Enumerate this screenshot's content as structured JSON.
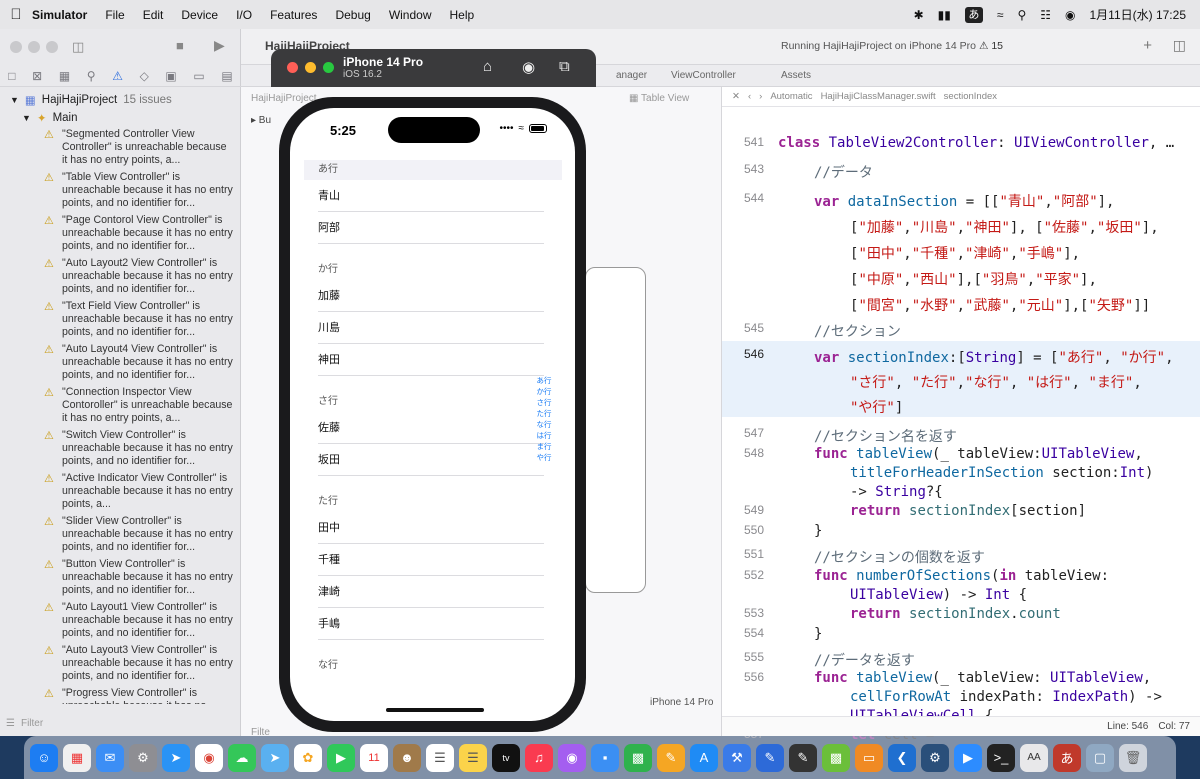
{
  "menubar": {
    "items": [
      "Simulator",
      "File",
      "Edit",
      "Device",
      "I/O",
      "Features",
      "Debug",
      "Window",
      "Help"
    ],
    "input_mode": "あ",
    "datetime": "1月11日(水) 17:25"
  },
  "xcode": {
    "project_title": "HajiHajiProject",
    "status": "Running HajiHajiProject on iPhone 14 Pro",
    "issue_count": "15",
    "tabs": [
      "anager",
      "ViewController",
      "Assets"
    ],
    "breadcrumb_left": "HajiHajiProject",
    "device_label": "iPhone 14 Pro",
    "filter_placeholder": "Filter"
  },
  "navigator": {
    "project": "HajiHajiProject",
    "project_issues": "15 issues",
    "group": "Main",
    "issues": [
      "\"Segmented Controller View Controller\" is unreachable because it has no entry points, a...",
      "\"Table View Controller\" is unreachable because it has no entry points, and no identifier for...",
      "\"Page Contorol View Controller\" is unreachable because it has no entry points, and no identifier for...",
      "\"Auto Layout2 View Controller\" is unreachable because it has no entry points, and no identifier for...",
      "\"Text Field View Controller\" is unreachable because it has no entry points, and no identifier for...",
      "\"Auto Layout4 View Controller\" is unreachable because it has no entry points, and no identifier for...",
      "\"Connection Inspector View Contoroller\" is unreachable because it has no entry points, a...",
      "\"Switch View Controller\" is unreachable because it has no entry points, and no identifier for...",
      "\"Active Indicator View Controller\" is unreachable because it has no entry points, a...",
      "\"Slider View Controller\" is unreachable because it has no entry points, and no identifier for...",
      "\"Button View Controller\" is unreachable because it has no entry points, and no identifier for...",
      "\"Auto Layout1 View Controller\" is unreachable because it has no entry points, and no identifier for...",
      "\"Auto Layout3 View Controller\" is unreachable because it has no entry points, and no identifier for...",
      "\"Progress View Controller\" is unreachable because it has no"
    ],
    "filter_placeholder": "Filter"
  },
  "code": {
    "jumpbar": [
      "Automatic",
      "HajiHajiClassManager.swift",
      "sectionIndex"
    ],
    "status": {
      "line": "Line: 546",
      "col": "Col: 77"
    }
  },
  "simulator": {
    "device": "iPhone 14 Pro",
    "os": "iOS 16.2",
    "time": "5:25",
    "sections": [
      {
        "header": "あ行",
        "rows": [
          "青山",
          "阿部"
        ]
      },
      {
        "header": "か行",
        "rows": [
          "加藤",
          "川島",
          "神田"
        ]
      },
      {
        "header": "さ行",
        "rows": [
          "佐藤",
          "坂田"
        ]
      },
      {
        "header": "た行",
        "rows": [
          "田中",
          "千種",
          "津崎",
          "手嶋"
        ]
      },
      {
        "header": "な行",
        "rows": []
      }
    ],
    "index": [
      "あ行",
      "か行",
      "さ行",
      "た行",
      "な行",
      "は行",
      "ま行",
      "や行"
    ]
  }
}
